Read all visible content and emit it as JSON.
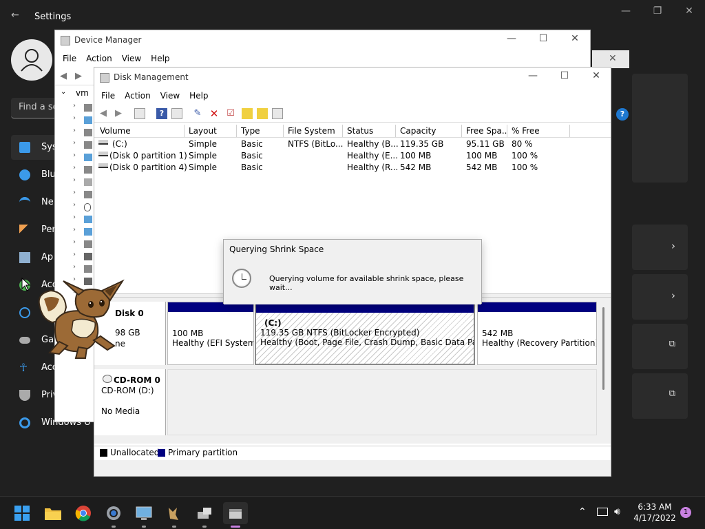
{
  "settings": {
    "title": "Settings",
    "search_placeholder": "Find a se",
    "nav": [
      {
        "label": "Sys",
        "icon": "monitor-icon",
        "color": "#3b9aea"
      },
      {
        "label": "Blu",
        "icon": "bluetooth-icon",
        "color": "#3b9aea"
      },
      {
        "label": "Ne",
        "icon": "wifi-icon",
        "color": "#3b9aea"
      },
      {
        "label": "Per",
        "icon": "brush-icon",
        "color": "#f0a050"
      },
      {
        "label": "Ap",
        "icon": "apps-icon",
        "color": "#8fb0d0"
      },
      {
        "label": "Acc",
        "icon": "accounts-icon",
        "color": "#4caf50"
      },
      {
        "label": "",
        "icon": "clock-icon",
        "color": "#3b9aea"
      },
      {
        "label": "Ga",
        "icon": "gamepad-icon",
        "color": "#aaaaaa"
      },
      {
        "label": "Acc",
        "icon": "accessibility-icon",
        "color": "#3b9aea"
      },
      {
        "label": "Priv",
        "icon": "shield-icon",
        "color": "#aaaaaa"
      },
      {
        "label": "Windows U",
        "icon": "update-icon",
        "color": "#3b9aea"
      }
    ]
  },
  "device_manager": {
    "title": "Device Manager",
    "menu": [
      "File",
      "Action",
      "View",
      "Help"
    ],
    "tree_root": "vm"
  },
  "disk_management": {
    "title": "Disk Management",
    "menu": [
      "File",
      "Action",
      "View",
      "Help"
    ],
    "columns": [
      "Volume",
      "Layout",
      "Type",
      "File System",
      "Status",
      "Capacity",
      "Free Spa...",
      "% Free"
    ],
    "rows": [
      [
        "(C:)",
        "Simple",
        "Basic",
        "NTFS (BitLo...",
        "Healthy (B...",
        "119.35 GB",
        "95.11 GB",
        "80 %"
      ],
      [
        "(Disk 0 partition 1)",
        "Simple",
        "Basic",
        "",
        "Healthy (E...",
        "100 MB",
        "100 MB",
        "100 %"
      ],
      [
        "(Disk 0 partition 4)",
        "Simple",
        "Basic",
        "",
        "Healthy (R...",
        "542 MB",
        "542 MB",
        "100 %"
      ]
    ],
    "disk0": {
      "name": "Disk 0",
      "size_fragment": "98 GB",
      "type_fragment": "ne",
      "partitions": [
        {
          "size": "100 MB",
          "status": "Healthy (EFI System P"
        },
        {
          "label": "(C:)",
          "size": "119.35 GB NTFS (BitLocker Encrypted)",
          "status": "Healthy (Boot, Page File, Crash Dump, Basic Data Partition"
        },
        {
          "size": "542 MB",
          "status": "Healthy (Recovery Partition)"
        }
      ]
    },
    "cdrom": {
      "name": "CD-ROM 0",
      "drive": "CD-ROM (D:)",
      "media": "No Media"
    },
    "legend": [
      {
        "label": "Unallocated",
        "color": "#000000"
      },
      {
        "label": "Primary partition",
        "color": "#000080"
      }
    ]
  },
  "dialog": {
    "title": "Querying Shrink Space",
    "message": "Querying volume for available shrink space, please wait..."
  },
  "taskbar": {
    "time": "6:33 AM",
    "date": "4/17/2022",
    "notification_count": "1"
  }
}
